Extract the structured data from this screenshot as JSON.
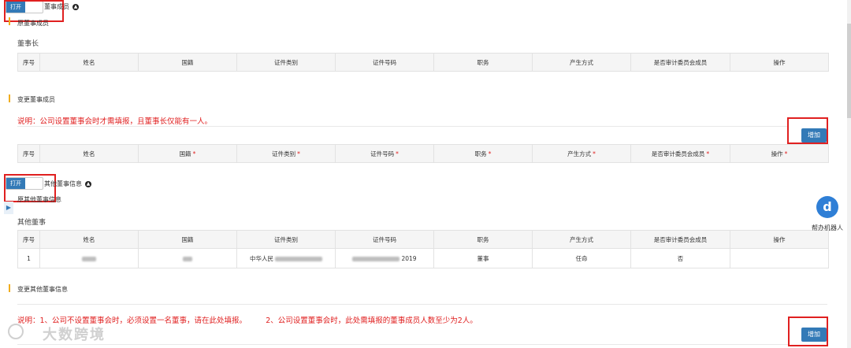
{
  "toggle_label": "打开",
  "section1": {
    "header": "董事成员",
    "original_title": "原董事成员",
    "chairman_subtitle": "董事长",
    "columns": [
      "序号",
      "姓名",
      "国籍",
      "证件类别",
      "证件号码",
      "职务",
      "产生方式",
      "是否审计委员会成员",
      "操作"
    ]
  },
  "change_directors": {
    "title": "变更董事成员",
    "note": "说明：公司设置董事会时才需填报，且董事长仅能有一人。",
    "add_button": "增加",
    "columns": [
      "序号",
      "姓名",
      "国籍",
      "证件类别",
      "证件号码",
      "职务",
      "产生方式",
      "是否审计委员会成员",
      "操作"
    ],
    "required_marker": "*"
  },
  "section2": {
    "header": "其他董事信息",
    "original_title": "原其他董事信息",
    "subtitle": "其他董事",
    "columns": [
      "序号",
      "姓名",
      "国籍",
      "证件类别",
      "证件号码",
      "职务",
      "产生方式",
      "是否审计委员会成员",
      "操作"
    ],
    "rows": [
      {
        "index": "1",
        "name_visible": "",
        "nationality_visible": "",
        "idtype_visible": "中华人民",
        "idno_visible": "2019",
        "position": "董事",
        "method": "任命",
        "audit": "否",
        "op": ""
      }
    ]
  },
  "change_other": {
    "title": "变更其他董事信息",
    "note": "说明：1、公司不设置董事会时，必须设置一名董事，请在此处填报。        2、公司设置董事会时，此处需填报的董事成员人数至少为2人。",
    "add_button": "增加"
  },
  "robot_label": "帮办机器人",
  "watermark": "大数跨境",
  "colors": {
    "accent": "#337ab7",
    "alert": "#e02020",
    "section_bar": "#f0ad1e"
  }
}
